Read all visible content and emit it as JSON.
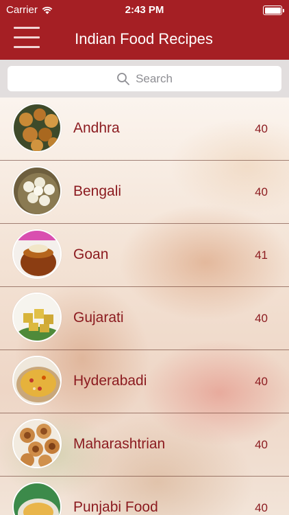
{
  "status_bar": {
    "carrier": "Carrier",
    "time": "2:43 PM"
  },
  "nav": {
    "title": "Indian Food Recipes"
  },
  "search": {
    "placeholder": "Search"
  },
  "categories": [
    {
      "label": "Andhra",
      "count": "40"
    },
    {
      "label": "Bengali",
      "count": "40"
    },
    {
      "label": "Goan",
      "count": "41"
    },
    {
      "label": "Gujarati",
      "count": "40"
    },
    {
      "label": "Hyderabadi",
      "count": "40"
    },
    {
      "label": "Maharashtrian",
      "count": "40"
    },
    {
      "label": "Punjabi Food",
      "count": "40"
    }
  ],
  "colors": {
    "brand": "#a51f24",
    "text": "#8b1a1f"
  }
}
